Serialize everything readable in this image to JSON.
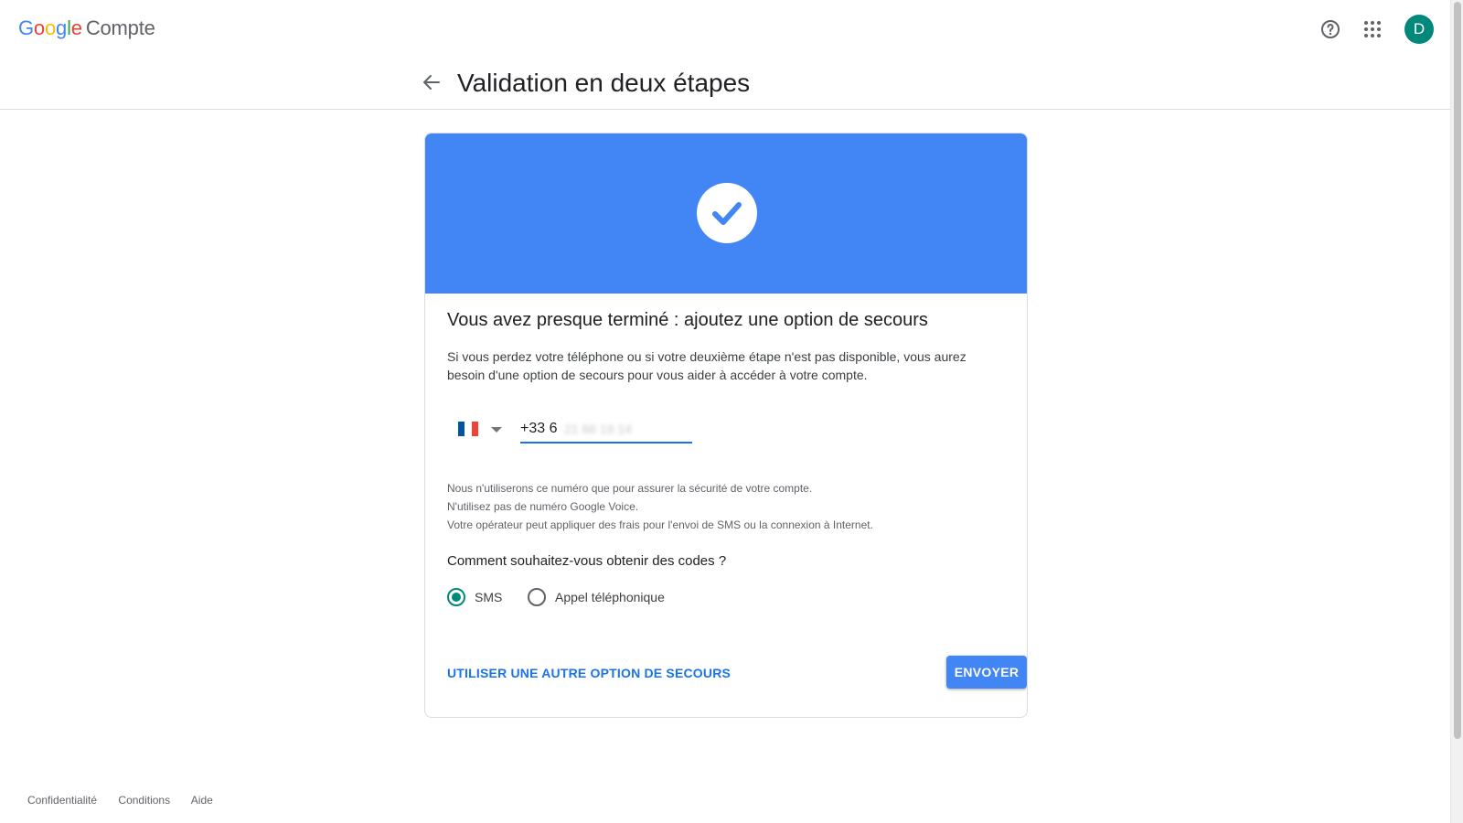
{
  "header": {
    "logo_letters": [
      "G",
      "o",
      "o",
      "g",
      "l",
      "e"
    ],
    "product_name": "Compte",
    "avatar_initial": "D",
    "avatar_color": "#00897b",
    "help_icon": "help-circle-icon",
    "apps_icon": "apps-grid-icon"
  },
  "subheader": {
    "title": "Validation en deux étapes",
    "back_icon": "arrow-back-icon"
  },
  "card": {
    "banner_color": "#4285f4",
    "banner_icon": "check-circle-icon",
    "heading": "Vous avez presque terminé : ajoutez une option de secours",
    "description": "Si vous perdez votre téléphone ou si votre deuxième étape n'est pas disponible, vous aurez besoin d'une option de secours pour vous aider à accéder à votre compte.",
    "country_flag": "france-flag-icon",
    "phone_value": "+33 6",
    "phone_blurred": "21 66 19 14",
    "notes": [
      "Nous n'utiliserons ce numéro que pour assurer la sécurité de votre compte.",
      "N'utilisez pas de numéro Google Voice.",
      "Votre opérateur peut appliquer des frais pour l'envoi de SMS ou la connexion à Internet."
    ],
    "question": "Comment souhaitez-vous obtenir des codes ?",
    "options": [
      {
        "label": "SMS",
        "selected": true
      },
      {
        "label": "Appel téléphonique",
        "selected": false
      }
    ],
    "alt_link": "UTILISER UNE AUTRE OPTION DE SECOURS",
    "send_button": "ENVOYER"
  },
  "footer": {
    "links": [
      "Confidentialité",
      "Conditions",
      "Aide"
    ]
  }
}
